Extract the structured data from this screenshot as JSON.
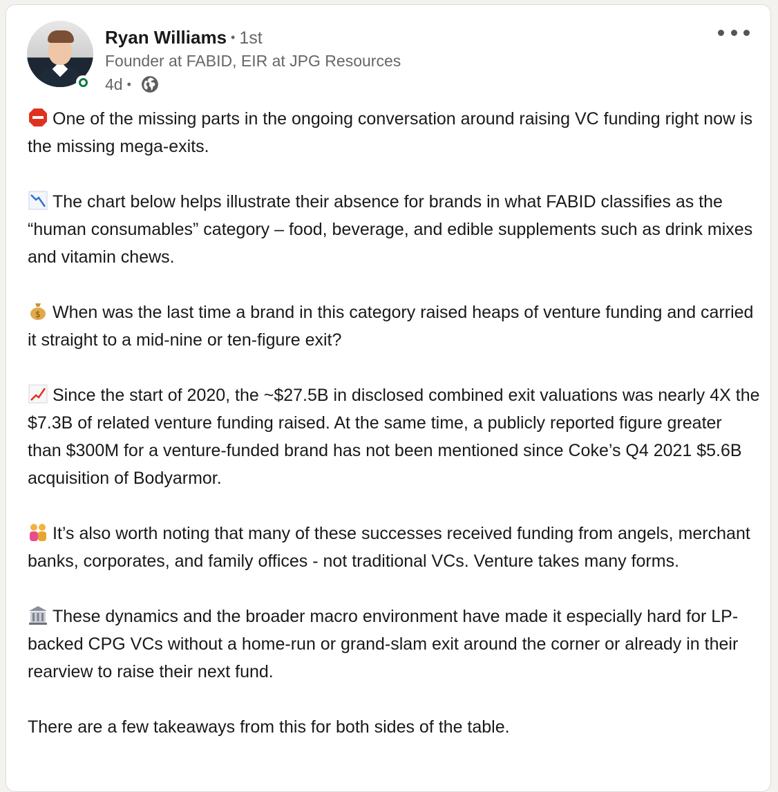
{
  "author": {
    "name": "Ryan Williams",
    "degree": "1st",
    "headline": "Founder at FABID, EIR at JPG Resources",
    "time": "4d",
    "visibility_icon": "globe-icon",
    "avatar": "profile-photo",
    "status": "online"
  },
  "menu": {
    "icon": "more-options-icon"
  },
  "colors": {
    "online": "#0a7b3e",
    "text": "#191919",
    "muted": "#666666"
  },
  "post": {
    "paragraphs": [
      {
        "icon": "stop-sign-emoji",
        "text": "One of the missing parts in the ongoing conversation around raising VC funding right now is the missing mega-exits."
      },
      {
        "icon": "chart-decreasing-emoji",
        "text": "The chart below helps illustrate their absence for brands in what FABID classifies as the “human consumables” category – food, beverage, and edible supplements such as drink mixes and vitamin chews."
      },
      {
        "icon": "money-bag-emoji",
        "text": "When was the last time a brand in this category raised heaps of venture funding and carried it straight to a mid-nine or ten-figure exit?"
      },
      {
        "icon": "chart-increasing-emoji",
        "text": "Since the start of 2020, the ~$27.5B in disclosed combined exit valuations was nearly 4X the $7.3B of related venture funding raised. At the same time, a publicly reported figure greater than $300M for a venture-funded brand has not been mentioned since Coke’s Q4 2021 $5.6B acquisition of Bodyarmor."
      },
      {
        "icon": "people-emoji",
        "text": "It’s also worth noting that many of these successes received funding from angels, merchant banks, corporates, and family offices - not traditional VCs. Venture takes many forms."
      },
      {
        "icon": "bank-emoji",
        "text": "These dynamics and the broader macro environment have made it especially hard for LP-backed CPG VCs without a home-run or grand-slam exit around the corner or already in their rearview to raise their next fund."
      },
      {
        "icon": "",
        "text": "There are a few takeaways from this for both sides of the table."
      }
    ]
  }
}
